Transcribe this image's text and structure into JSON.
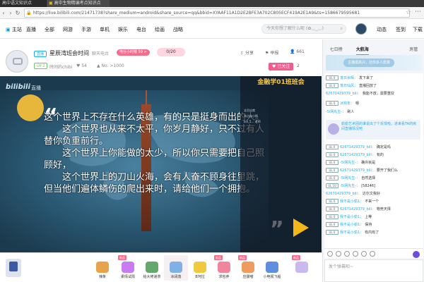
{
  "browser": {
    "tab1": "高中语文知识点",
    "tab2": "高中生物精编考点知识点",
    "url": "https://live.bilibili.com/21471738?share_medium=android&share_source=qq&bbid=XYAAF11A1D2E2BFE3A702C805ECF419A2E1A9&ts=1586679595681"
  },
  "topnav": {
    "items": [
      "主站",
      "直播",
      "全部",
      "网游",
      "手游",
      "单机",
      "娱乐",
      "电台",
      "绘画",
      "战略"
    ],
    "search_placeholder": "今天你想了解什么呢 (✿◡‿◡)",
    "right_items": [
      "动态",
      "签到",
      "下载"
    ]
  },
  "room": {
    "live_badge": "直播",
    "title": "星辰湾班会时间",
    "announce": "聊天电台",
    "pill_red": "电台小时榜 59 >",
    "pill_pink": "0/20",
    "icons": [
      "分享",
      "举报",
      "661"
    ],
    "up_badge": "UP 2",
    "host": "时间的chibi",
    "fans": "54",
    "rank": "No. >1000",
    "follow": "已关注",
    "follow_count": "2"
  },
  "video": {
    "watermark": "bilibili",
    "watermark_sub": "直播",
    "text": "这个世界上不存在什么英雄，有的只是挺身而出的人。\n　　这个世界也从来不太平，你岁月静好，只不过有人替你负重前行。\n　　这个世界上你能做的太少，所以你只需要把自己照顾好，\n　　这个世界上的刀山火海，会有人奋不顾身往里跳，但当他们遍体鳞伤的爬出来时，请给他们一个拥抱。",
    "overlay_title": "金融学01班班会",
    "overlay_lines": [
      "",
      "",
      "",
      "全员出席",
      "冰点@小杨",
      "bili_5… 老师",
      "",
      "",
      "",
      "",
      "",
      "",
      "",
      "",
      "",
      "",
      "",
      "",
      "",
      "",
      "",
      "",
      "",
      ""
    ]
  },
  "gifts": [
    {
      "name": "辣条",
      "tag": "",
      "color": "#e7a24c"
    },
    {
      "name": "柔情试陨",
      "tag": "新品",
      "color": "#c97cf2"
    },
    {
      "name": "给大佬递茶",
      "tag": "",
      "color": "#65a86b"
    },
    {
      "name": "冰阔落",
      "tag": "",
      "color": "#7fb0e6"
    },
    {
      "name": "B坷拉",
      "tag": "",
      "color": "#f1c93d"
    },
    {
      "name": "求包养",
      "tag": "新品",
      "color": "#f2859e"
    },
    {
      "name": "应援喵",
      "tag": "新品",
      "color": "#ef9a5f"
    },
    {
      "name": "小电视飞船",
      "tag": "",
      "color": "#5d8ee0"
    },
    {
      "name": "",
      "tag": "新品",
      "color": "#c8b9ee"
    }
  ],
  "chat": {
    "tabs": [
      "七日榜",
      "大航海",
      "",
      "",
      "房管"
    ],
    "banner": "主播很高兴，还你多人愿意",
    "messages": [
      {
        "lvl": "UL 0",
        "user": "落日余晖：",
        "text": "发下来了"
      },
      {
        "lvl": "UL 0",
        "user": "落日仙风：",
        "text": "直播回放了"
      },
      {
        "lvl": "",
        "user": "626714293​79_bili：",
        "text": "我能不放，需要重授"
      },
      {
        "lvl": "UL 0",
        "user": "冰狗年：",
        "text": "嗯"
      },
      {
        "lvl": "",
        "user": "-5l网先生-：",
        "text": "刷人"
      },
      {
        "lvl": "UL 0",
        "user": "626714293​79_bili：",
        "text": "确定是吗"
      },
      {
        "lvl": "UL 0",
        "user": "626714293​79_bili：",
        "text": "有的"
      },
      {
        "lvl": "UL 0",
        "user": "-5l网先生-：",
        "text": "确许就是"
      },
      {
        "lvl": "UL 0",
        "user": "626714293​79_bili：",
        "text": "要开了我们么"
      },
      {
        "lvl": "UL 0",
        "user": "-5l网先生-：",
        "text": "自然选择"
      },
      {
        "lvl": "UL 10",
        "user": "-5l网先生-：",
        "text": "[58246]"
      },
      {
        "lvl": "",
        "user": "626714293​79_bili：",
        "text": "达尔文我好"
      },
      {
        "lvl": "UL 0",
        "user": "我不是小偷1：",
        "text": "不来一个"
      },
      {
        "lvl": "UL 0",
        "user": "626714293​79_bili：",
        "text": "物竞天择"
      },
      {
        "lvl": "UL 0",
        "user": "我不是小偷1：",
        "text": "上等"
      },
      {
        "lvl": "UL 0",
        "user": "我不是小偷1：",
        "text": "保持"
      },
      {
        "lvl": "UL 0",
        "user": "我不是小偷1：",
        "text": "有内有了"
      }
    ],
    "sysbox": "偷偷艺术团的谁说出了个反馈啦，进来看TA的房间直播情况吧",
    "input_placeholder": "发个弹幕呗~"
  }
}
